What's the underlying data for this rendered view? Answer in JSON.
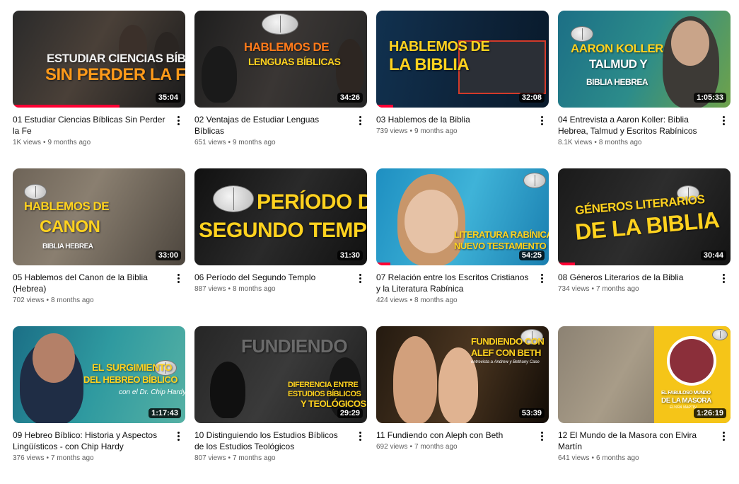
{
  "videos": [
    {
      "title": "01 Estudiar Ciencias Bíblicas Sin Perder la Fe",
      "views": "1K views",
      "age": "9 months ago",
      "duration": "35:04",
      "progress": 0.62,
      "thumb_lines": [
        "ESTUDIAR CIENCIAS BÍBLICAS",
        "SIN PERDER LA FE"
      ]
    },
    {
      "title": "02 Ventajas de Estudiar Lenguas Bíblicas",
      "views": "651 views",
      "age": "9 months ago",
      "duration": "34:26",
      "progress": 0.0,
      "thumb_lines": [
        "HABLEMOS DE",
        "LENGUAS BÍBLICAS"
      ]
    },
    {
      "title": "03 Hablemos de la Biblia",
      "views": "739 views",
      "age": "9 months ago",
      "duration": "32:08",
      "progress": 0.1,
      "thumb_lines": [
        "HABLEMOS DE",
        "LA BIBLIA"
      ]
    },
    {
      "title": "04 Entrevista a Aaron Koller: Biblia Hebrea, Talmud y Escritos Rabínicos",
      "views": "8.1K views",
      "age": "8 months ago",
      "duration": "1:05:33",
      "progress": 0.0,
      "thumb_lines": [
        "AARON KOLLER",
        "TALMUD Y",
        "BIBLIA HEBREA"
      ]
    },
    {
      "title": "05 Hablemos del Canon de la Biblia (Hebrea)",
      "views": "702 views",
      "age": "8 months ago",
      "duration": "33:00",
      "progress": 0.0,
      "thumb_lines": [
        "HABLEMOS DE",
        "CANON",
        "BIBLIA HEBREA"
      ]
    },
    {
      "title": "06 Período del Segundo Templo",
      "views": "887 views",
      "age": "8 months ago",
      "duration": "31:30",
      "progress": 0.0,
      "thumb_lines": [
        "PERÍODO DEL",
        "SEGUNDO TEMPLO"
      ]
    },
    {
      "title": "07 Relación entre los Escritos Cristianos y la Literatura Rabínica",
      "views": "424 views",
      "age": "8 months ago",
      "duration": "54:25",
      "progress": 0.08,
      "thumb_lines": [
        "LITERATURA RABÍNICA",
        "NUEVO TESTAMENTO"
      ]
    },
    {
      "title": "08 Géneros Literarios de la Biblia",
      "views": "734 views",
      "age": "7 months ago",
      "duration": "30:44",
      "progress": 0.1,
      "thumb_lines": [
        "GÉNEROS LITERARIOS",
        "DE LA BIBLIA"
      ]
    },
    {
      "title": "09 Hebreo Bíblico: Historia y Aspectos Lingüísticos - con Chip Hardy",
      "views": "376 views",
      "age": "7 months ago",
      "duration": "1:17:43",
      "progress": 0.0,
      "thumb_lines": [
        "EL SURGIMIENTO",
        "DEL HEBREO BÍBLICO",
        "con el Dr. Chip Hardy"
      ]
    },
    {
      "title": "10 Distinguiendo los Estudios Bíblicos de los Estudios Teológicos",
      "views": "807 views",
      "age": "7 months ago",
      "duration": "29:29",
      "progress": 0.0,
      "thumb_lines": [
        "FUNDIENDO",
        "DIFERENCIA ENTRE",
        "ESTUDIOS BÍBLICOS",
        "Y TEOLÓGICOS"
      ]
    },
    {
      "title": "11 Fundiendo con Aleph con Beth",
      "views": "692 views",
      "age": "7 months ago",
      "duration": "53:39",
      "progress": 0.0,
      "thumb_lines": [
        "FUNDIENDO CON",
        "ALEF CON BETH",
        "entrevista a Andrew y Bethany Case"
      ]
    },
    {
      "title": "12 El Mundo de la Masora con Elvira Martín",
      "views": "641 views",
      "age": "6 months ago",
      "duration": "1:26:19",
      "progress": 0.0,
      "thumb_lines": [
        "EL FABULOSO MUNDO",
        "DE LA MASORA",
        "ELVIRA MARTÍN"
      ]
    }
  ],
  "colors": {
    "accent_yellow": "#ffd21f",
    "accent_orange": "#ff7a1a",
    "progress_red": "#ff0033",
    "meta_gray": "#606060"
  }
}
